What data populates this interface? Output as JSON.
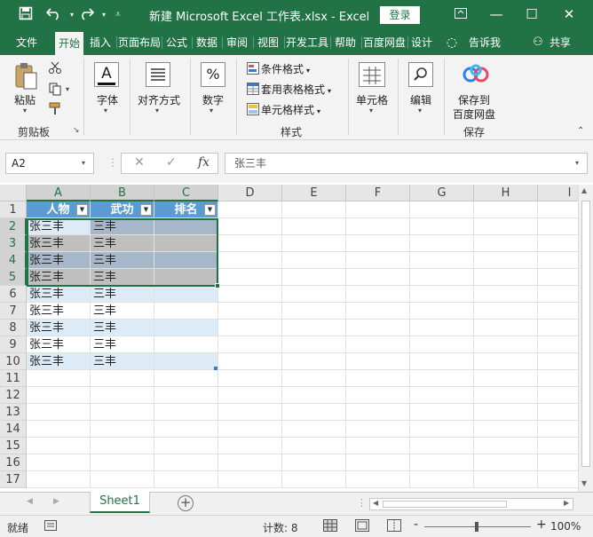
{
  "titlebar": {
    "title": "新建 Microsoft Excel 工作表.xlsx  -  Excel",
    "login": "登录",
    "save_icon": "save-icon",
    "undo_icon": "undo-icon",
    "redo_icon": "redo-icon",
    "colors": {
      "excel_green": "#217346"
    }
  },
  "ribbon_tabs": [
    "文件",
    "开始",
    "插入",
    "页面布局",
    "公式",
    "数据",
    "审阅",
    "视图",
    "开发工具",
    "帮助",
    "百度网盘",
    "设计"
  ],
  "ribbon_active_tab": "开始",
  "tell_me": "告诉我",
  "share": "共享",
  "ribbon": {
    "clipboard": {
      "paste": "粘贴",
      "group": "剪贴板"
    },
    "font": {
      "label": "字体"
    },
    "alignment": {
      "label": "对齐方式"
    },
    "number": {
      "label": "数字"
    },
    "styles": {
      "conditional": "条件格式",
      "table": "套用表格格式",
      "cell_styles": "单元格样式",
      "group": "样式"
    },
    "cells": {
      "label": "单元格"
    },
    "editing": {
      "label": "编辑"
    },
    "save": {
      "label_line1": "保存到",
      "label_line2": "百度网盘",
      "group": "保存"
    }
  },
  "formula_bar": {
    "name_box": "A2",
    "cancel": "✕",
    "enter": "✓",
    "fx": "fx",
    "content": "张三丰"
  },
  "grid": {
    "columns": [
      "A",
      "B",
      "C",
      "D",
      "E",
      "F",
      "G",
      "H",
      "I"
    ],
    "rows": [
      "1",
      "2",
      "3",
      "4",
      "5",
      "6",
      "7",
      "8",
      "9",
      "10",
      "11",
      "12",
      "13",
      "14",
      "15",
      "16",
      "17"
    ],
    "header": [
      "人物",
      "武功",
      "排名"
    ],
    "data": [
      [
        "张三丰",
        "三丰",
        ""
      ],
      [
        "张三丰",
        "三丰",
        ""
      ],
      [
        "张三丰",
        "三丰",
        ""
      ],
      [
        "张三丰",
        "三丰",
        ""
      ],
      [
        "张三丰",
        "三丰",
        ""
      ],
      [
        "张三丰",
        "三丰",
        ""
      ],
      [
        "张三丰",
        "三丰",
        ""
      ],
      [
        "张三丰",
        "三丰",
        ""
      ],
      [
        "张三丰",
        "三丰",
        ""
      ]
    ],
    "colors": {
      "table_header": "#5b9bd5",
      "band": "#ddebf7",
      "selection": "#217346"
    }
  },
  "sheets": {
    "tabs": [
      "Sheet1"
    ],
    "active": "Sheet1",
    "add": "+"
  },
  "status": {
    "ready": "就绪",
    "count": "计数: 8",
    "zoom": "100%",
    "minus": "-",
    "plus": "+"
  }
}
